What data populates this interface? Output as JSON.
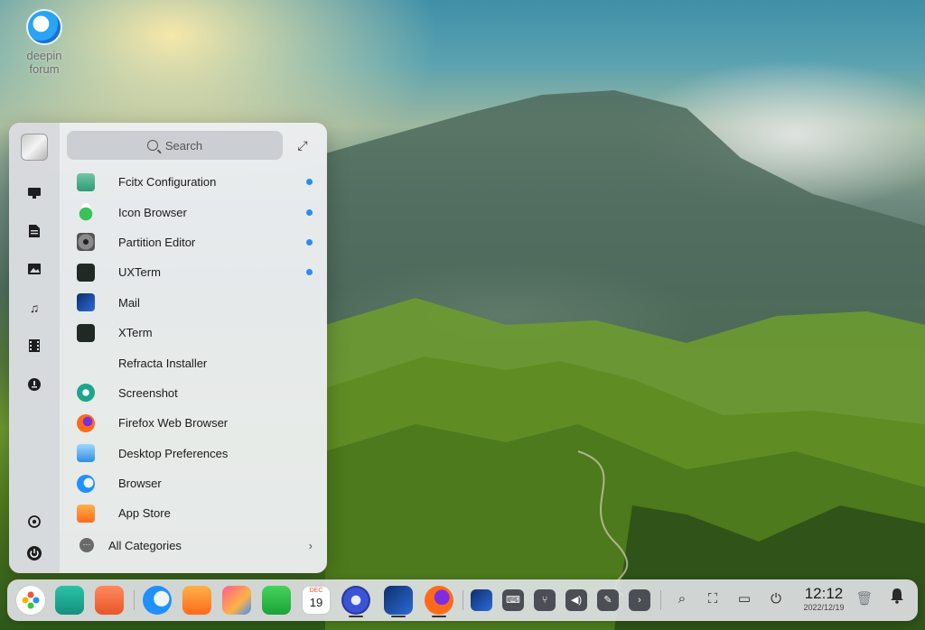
{
  "desktop": {
    "icon_label": "deepin forum"
  },
  "launcher": {
    "search_placeholder": "Search",
    "apps": [
      {
        "name": "Fcitx Configuration",
        "new": true
      },
      {
        "name": "Icon Browser",
        "new": true
      },
      {
        "name": "Partition Editor",
        "new": true
      },
      {
        "name": "UXTerm",
        "new": true
      },
      {
        "name": "Mail",
        "new": false
      },
      {
        "name": "XTerm",
        "new": false
      },
      {
        "name": "Refracta Installer",
        "new": false
      },
      {
        "name": "Screenshot",
        "new": false
      },
      {
        "name": "Firefox Web Browser",
        "new": false
      },
      {
        "name": "Desktop Preferences",
        "new": false
      },
      {
        "name": "Browser",
        "new": false
      },
      {
        "name": "App Store",
        "new": false
      }
    ],
    "all_categories": "All Categories"
  },
  "dock": {
    "time": "12:12",
    "date": "2022/12/19",
    "calendar_day": "19",
    "calendar_month": "DEC"
  },
  "colors": {
    "new_dot": "#2a8cf0",
    "dock_bg": "#dee1e4"
  }
}
